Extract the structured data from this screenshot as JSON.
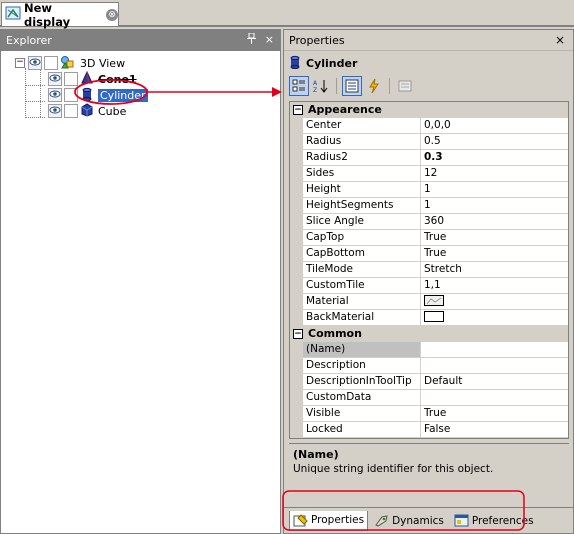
{
  "document_tab": {
    "title": "New display",
    "close_symbol": "⊗"
  },
  "explorer": {
    "title": "Explorer",
    "pin_symbol": "ᵖ",
    "close_symbol": "×",
    "tree": [
      {
        "label": "3D View",
        "icon": "3d-view-icon",
        "state": "expanded"
      },
      {
        "label": "Cone1",
        "icon": "cone-icon",
        "style": "strikethrough-bold"
      },
      {
        "label": "Cylinder",
        "icon": "cylinder-icon",
        "state": "selected"
      },
      {
        "label": "Cube",
        "icon": "cube-icon"
      }
    ]
  },
  "properties": {
    "title": "Properties",
    "close_symbol": "×",
    "object_name": "Cylinder",
    "toolbar": [
      "categorized-icon",
      "alphabetical-icon",
      "properties-icon",
      "events-icon",
      "property-pages-icon"
    ],
    "categories": [
      {
        "name": "Appearence",
        "rows": [
          {
            "name": "Center",
            "value": "0,0,0"
          },
          {
            "name": "Radius",
            "value": "0.5"
          },
          {
            "name": "Radius2",
            "value": "0.3",
            "bold": true
          },
          {
            "name": "Sides",
            "value": "12"
          },
          {
            "name": "Height",
            "value": "1"
          },
          {
            "name": "HeightSegments",
            "value": "1"
          },
          {
            "name": "Slice Angle",
            "value": "360"
          },
          {
            "name": "CapTop",
            "value": "True"
          },
          {
            "name": "CapBottom",
            "value": "True"
          },
          {
            "name": "TileMode",
            "value": "Stretch"
          },
          {
            "name": "CustomTile",
            "value": "1,1"
          },
          {
            "name": "Material",
            "value": "",
            "swatch": "material"
          },
          {
            "name": "BackMaterial",
            "value": "",
            "swatch": "blank"
          }
        ]
      },
      {
        "name": "Common",
        "rows": [
          {
            "name": "(Name)",
            "value": "",
            "selected": true
          },
          {
            "name": "Description",
            "value": ""
          },
          {
            "name": "DescriptionInToolTip",
            "value": "Default"
          },
          {
            "name": "CustomData",
            "value": ""
          },
          {
            "name": "Visible",
            "value": "True"
          },
          {
            "name": "Locked",
            "value": "False"
          }
        ]
      }
    ],
    "help": {
      "title": "(Name)",
      "description": "Unique string identifier for this object."
    },
    "bottom_tabs": [
      {
        "label": "Properties",
        "icon": "properties-tab-icon",
        "active": true
      },
      {
        "label": "Dynamics",
        "icon": "dynamics-tab-icon"
      },
      {
        "label": "Preferences",
        "icon": "preferences-tab-icon"
      }
    ]
  },
  "colors": {
    "selection": "#316ac5",
    "annotation": "#e3001b",
    "chrome": "#d4d0c8"
  }
}
